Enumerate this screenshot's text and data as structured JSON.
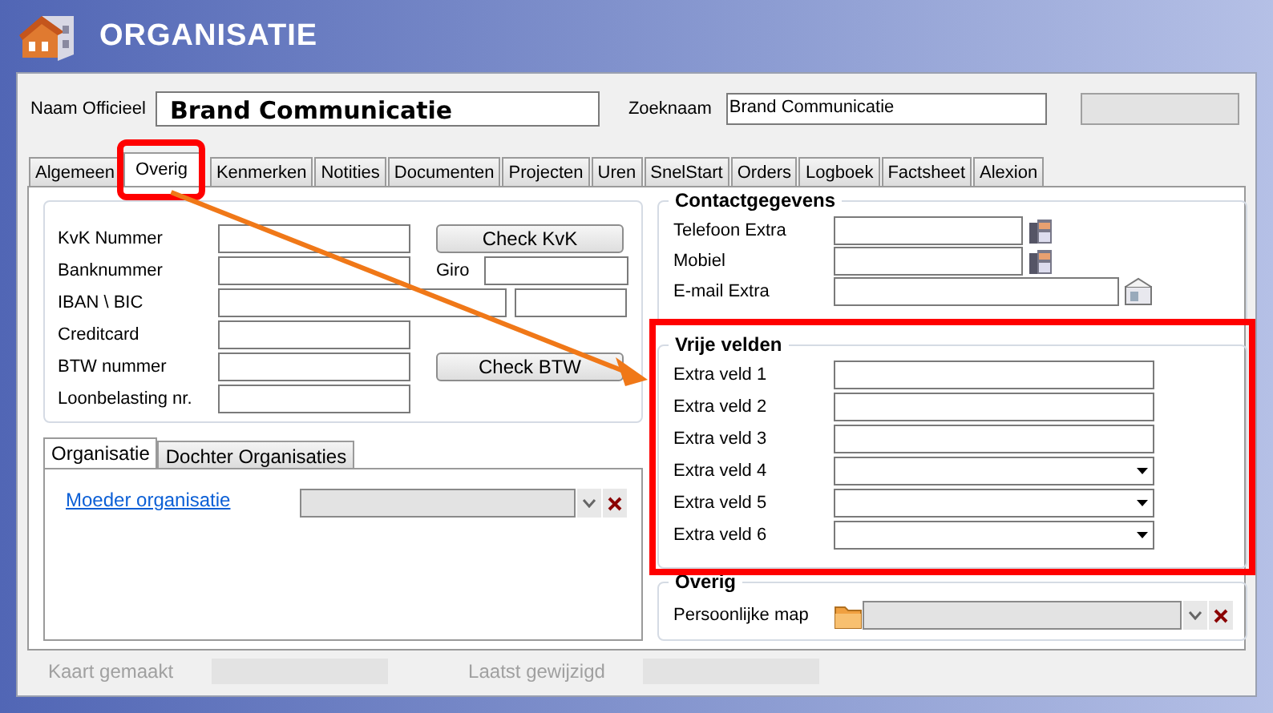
{
  "window": {
    "title": "ORGANISATIE"
  },
  "header": {
    "name_label": "Naam Officieel",
    "name_value": "Brand Communicatie",
    "search_label": "Zoeknaam",
    "search_value": "Brand Communicatie"
  },
  "tabs": [
    {
      "label": "Algemeen",
      "selected": false
    },
    {
      "label": "Overig",
      "selected": true
    },
    {
      "label": "Kenmerken",
      "selected": false
    },
    {
      "label": "Notities",
      "selected": false
    },
    {
      "label": "Documenten",
      "selected": false
    },
    {
      "label": "Projecten",
      "selected": false
    },
    {
      "label": "Uren",
      "selected": false
    },
    {
      "label": "SnelStart",
      "selected": false
    },
    {
      "label": "Orders",
      "selected": false
    },
    {
      "label": "Logboek",
      "selected": false
    },
    {
      "label": "Factsheet",
      "selected": false
    },
    {
      "label": "Alexion",
      "selected": false
    }
  ],
  "registration": [
    {
      "label": "KvK Nummer",
      "kind": "button",
      "button": "Check KvK"
    },
    {
      "label": "Banknummer",
      "kind": "extra-field",
      "extra_label": "Giro"
    },
    {
      "label": "IBAN \\ BIC",
      "kind": "split"
    },
    {
      "label": "Creditcard",
      "kind": "plain"
    },
    {
      "label": "BTW nummer",
      "kind": "button",
      "button": "Check BTW"
    },
    {
      "label": "Loonbelasting nr.",
      "kind": "plain"
    }
  ],
  "sub_tabs": [
    {
      "label": "Organisatie",
      "selected": true
    },
    {
      "label": "Dochter Organisaties",
      "selected": false
    }
  ],
  "parent_link": "Moeder organisatie ",
  "contact": {
    "title": "Contactgegevens",
    "rows": [
      {
        "label": "Telefoon Extra",
        "kind": "phone"
      },
      {
        "label": "Mobiel",
        "kind": "phone"
      },
      {
        "label": "E-mail Extra",
        "kind": "email"
      }
    ]
  },
  "free_fields": {
    "title": "Vrije velden",
    "rows": [
      {
        "label": "Extra veld 1",
        "kind": "text"
      },
      {
        "label": "Extra veld 2",
        "kind": "text"
      },
      {
        "label": "Extra veld 3",
        "kind": "text"
      },
      {
        "label": "Extra veld 4",
        "kind": "dropdown"
      },
      {
        "label": "Extra veld 5",
        "kind": "dropdown"
      },
      {
        "label": "Extra veld 6",
        "kind": "dropdown"
      }
    ]
  },
  "other": {
    "title": "Overig",
    "folder_label": "Persoonlijke map"
  },
  "footer": [
    {
      "label": "Kaart gemaakt",
      "disabled": true
    },
    {
      "label": "Laatst gewijzigd",
      "disabled": true
    }
  ]
}
